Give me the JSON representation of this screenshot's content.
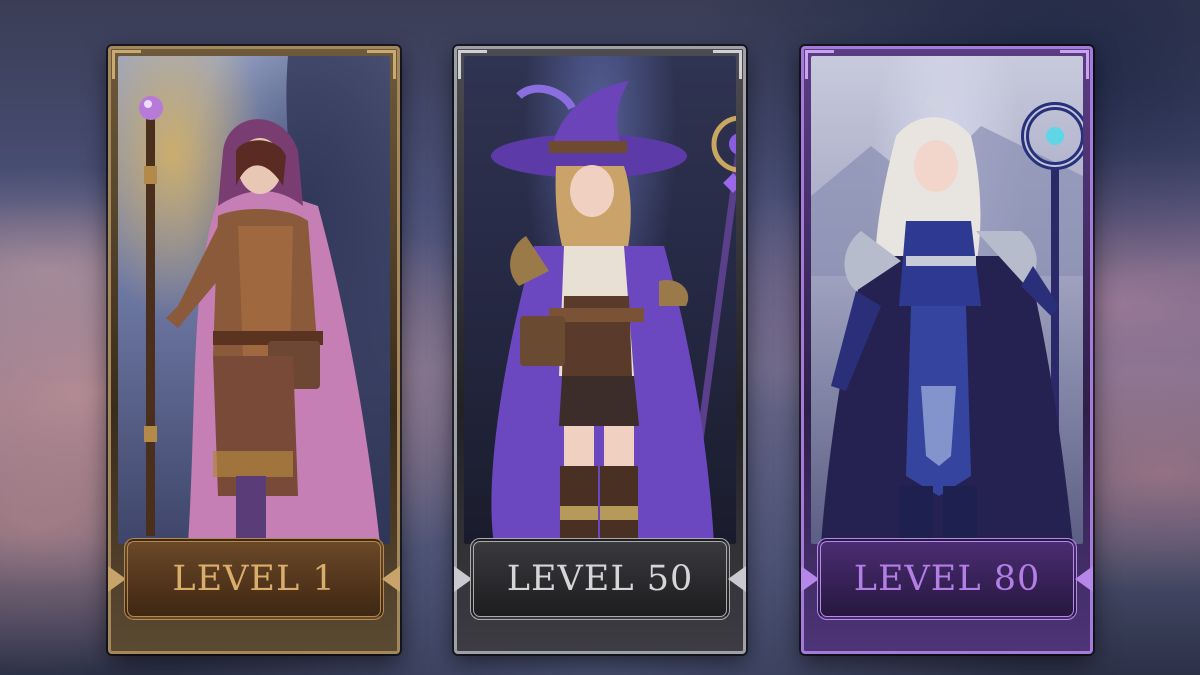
{
  "cards": [
    {
      "level_label": "LEVEL 1",
      "tier": "bronze",
      "character": "hooded-mage",
      "accent_color": "#d9ad6c"
    },
    {
      "level_label": "LEVEL 50",
      "tier": "silver",
      "character": "witch-hat-mage",
      "accent_color": "#d6d6d8"
    },
    {
      "level_label": "LEVEL 80",
      "tier": "violet",
      "character": "armored-sorceress",
      "accent_color": "#b37ee6"
    }
  ]
}
